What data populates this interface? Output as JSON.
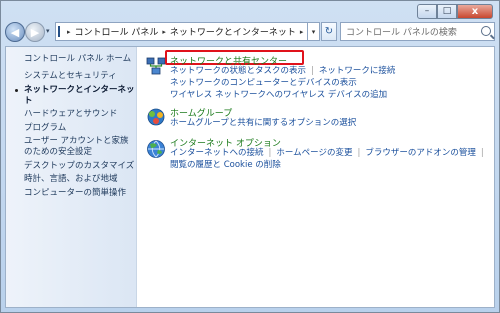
{
  "window": {
    "controls": {
      "minimize": "–",
      "maximize": "□",
      "close": "x"
    }
  },
  "nav": {
    "back_icon": "back-arrow-icon",
    "forward_icon": "forward-arrow-icon",
    "history_dropdown": "▾",
    "breadcrumbs": [
      "コントロール パネル",
      "ネットワークとインターネット"
    ],
    "separator": "▸",
    "address_dropdown": "▾",
    "refresh_label": "↻",
    "search_placeholder": "コントロール パネルの検索"
  },
  "sidebar": {
    "home_link": "コントロール パネル ホーム",
    "items": [
      {
        "label": "システムとセキュリティ",
        "current": false
      },
      {
        "label": "ネットワークとインターネット",
        "current": true
      },
      {
        "label": "ハードウェアとサウンド",
        "current": false
      },
      {
        "label": "プログラム",
        "current": false
      },
      {
        "label": "ユーザー アカウントと家族のための安全設定",
        "current": false
      },
      {
        "label": "デスクトップのカスタマイズ",
        "current": false
      },
      {
        "label": "時計、言語、および地域",
        "current": false
      },
      {
        "label": "コンピューターの簡単操作",
        "current": false
      }
    ]
  },
  "sections": [
    {
      "title": "ネットワークと共有センター",
      "icon": "network-sharing-icon",
      "highlighted": true,
      "links": [
        [
          "ネットワークの状態とタスクの表示",
          "ネットワークに接続"
        ],
        [
          "ネットワークのコンピューターとデバイスの表示"
        ],
        [
          "ワイヤレス ネットワークへのワイヤレス デバイスの追加"
        ]
      ]
    },
    {
      "title": "ホームグループ",
      "icon": "homegroup-icon",
      "highlighted": false,
      "links": [
        [
          "ホームグループと共有に関するオプションの選択"
        ]
      ]
    },
    {
      "title": "インターネット オプション",
      "icon": "internet-options-icon",
      "highlighted": false,
      "links": [
        [
          "インターネットへの接続",
          "ホームページの変更",
          "ブラウザーのアドオンの管理"
        ],
        [
          "閲覧の履歴と Cookie の削除"
        ]
      ]
    }
  ],
  "colors": {
    "highlight_border": "#e0121b",
    "section_title": "#1a7a1a",
    "link": "#1a4f9c"
  }
}
